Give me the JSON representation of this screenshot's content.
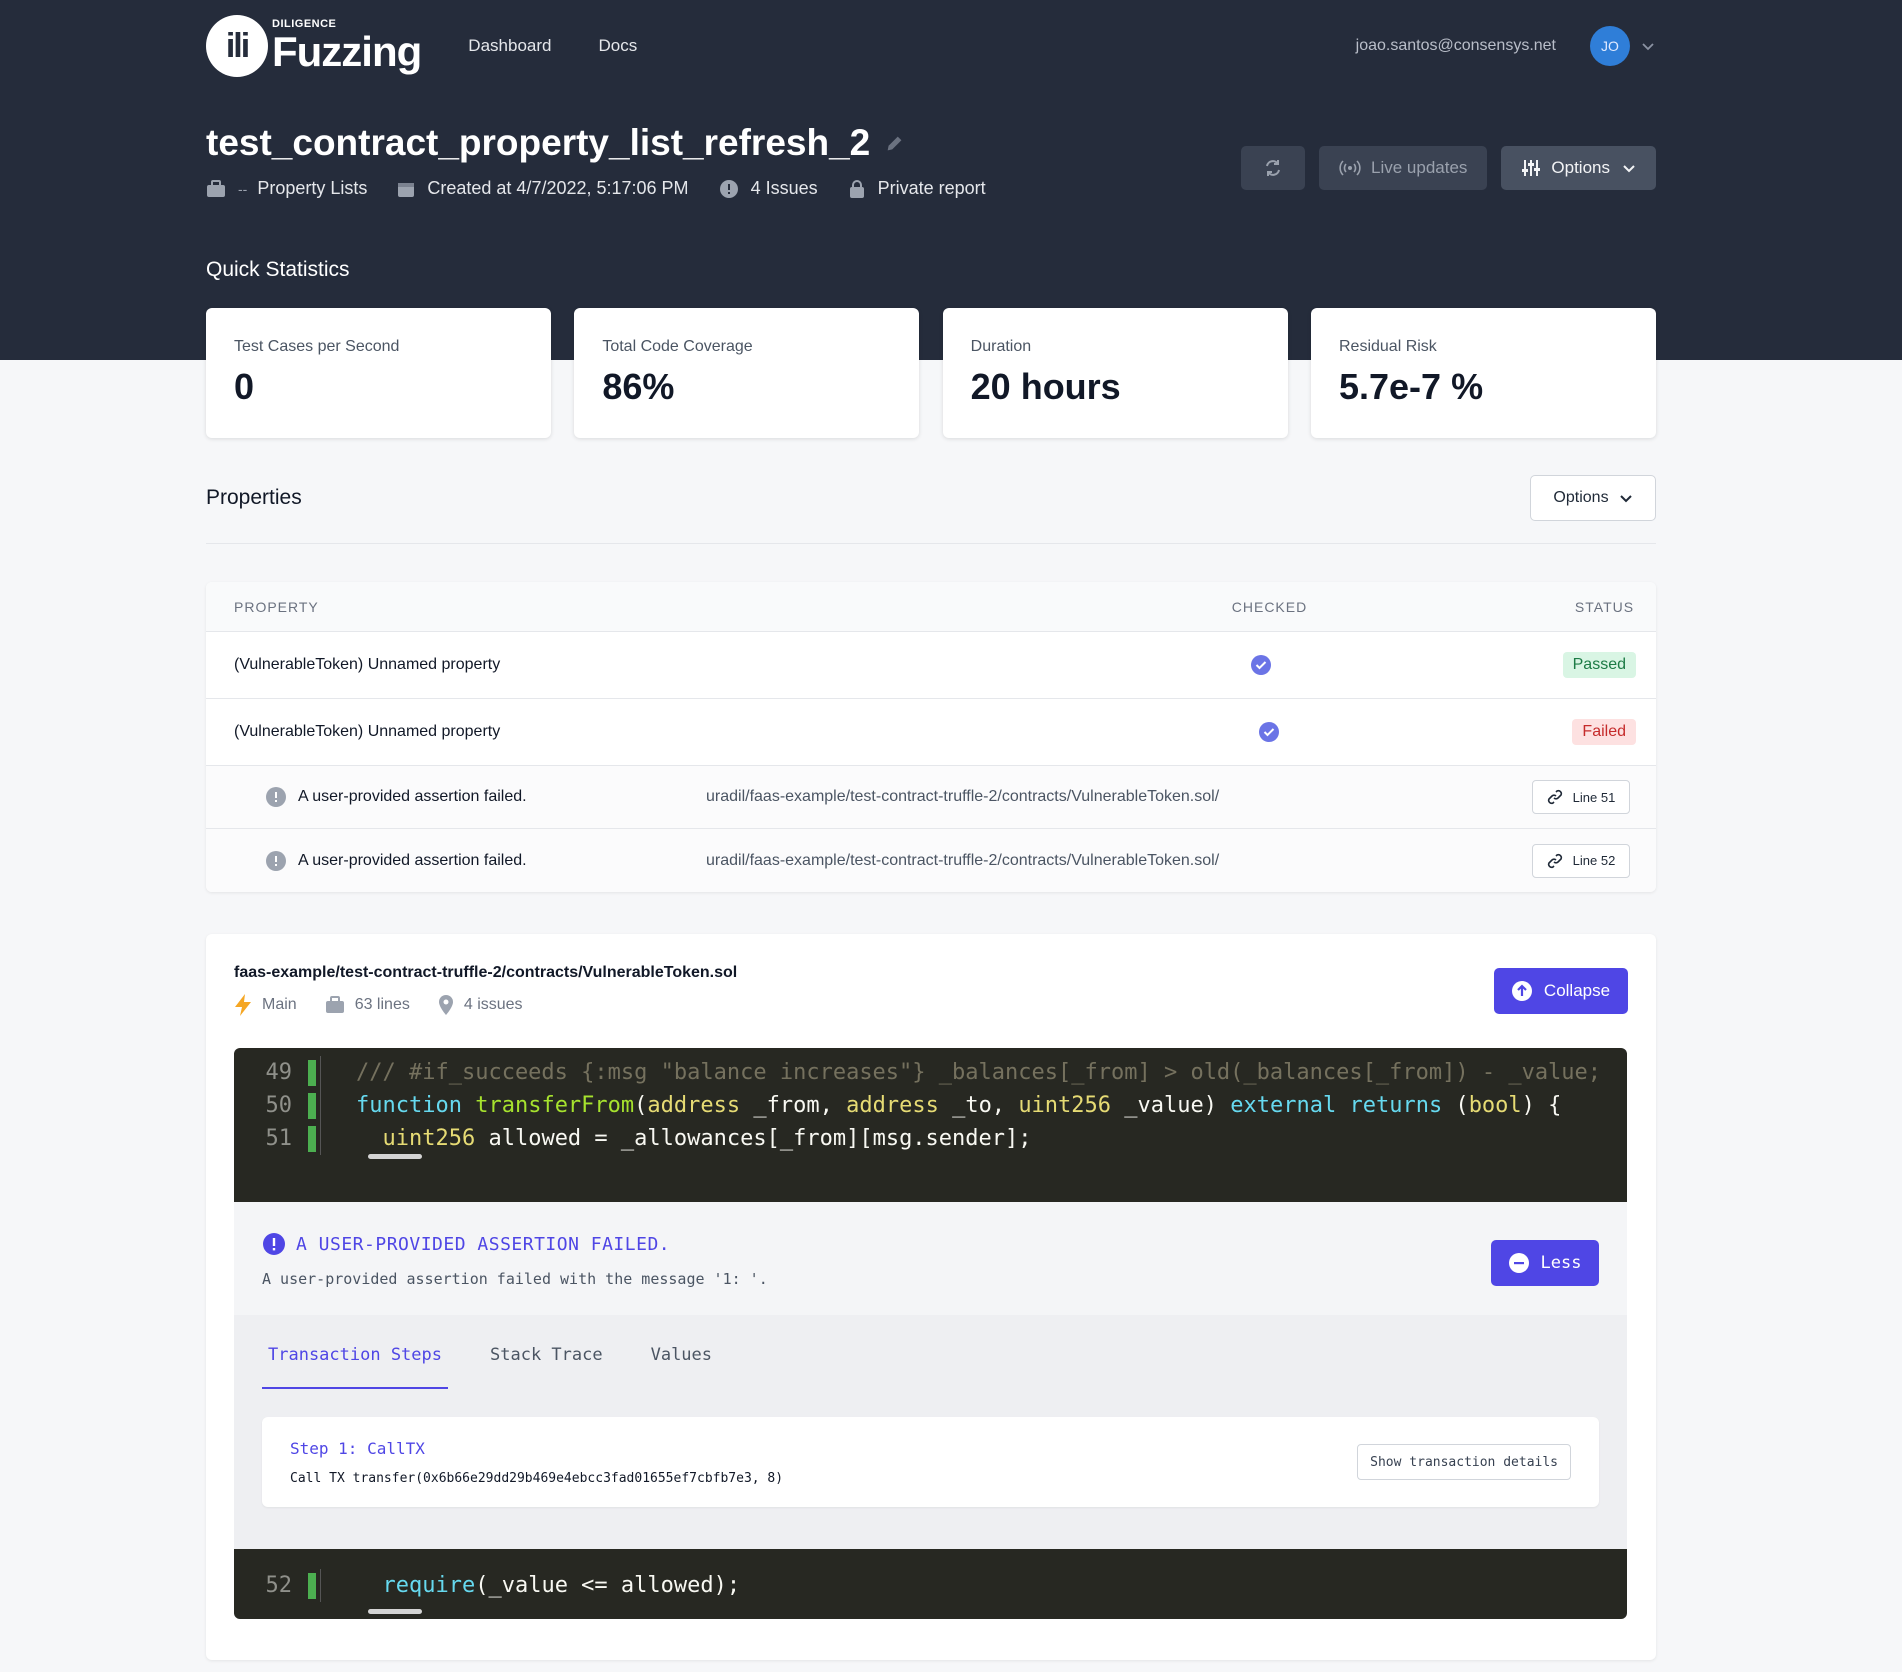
{
  "nav": {
    "logo_mark": "ili",
    "logo_small": "DILIGENCE",
    "logo_big": "Fuzzing",
    "links": [
      "Dashboard",
      "Docs"
    ],
    "email": "joao.santos@consensys.net",
    "avatar_initials": "JO"
  },
  "header": {
    "title": "test_contract_property_list_refresh_2",
    "meta_dash": "--",
    "meta_project": "Property Lists",
    "meta_created": "Created at 4/7/2022, 5:17:06 PM",
    "meta_issues": "4 Issues",
    "meta_privacy": "Private report",
    "live_updates_label": "Live updates",
    "options_label": "Options"
  },
  "quick_stats": {
    "label": "Quick Statistics",
    "items": [
      {
        "label": "Test Cases per Second",
        "value": "0"
      },
      {
        "label": "Total Code Coverage",
        "value": "86%"
      },
      {
        "label": "Duration",
        "value": "20 hours"
      },
      {
        "label": "Residual Risk",
        "value": "5.7e-7 %"
      }
    ]
  },
  "properties": {
    "title": "Properties",
    "options_label": "Options",
    "columns": [
      "PROPERTY",
      "CHECKED",
      "STATUS"
    ],
    "rows": [
      {
        "name": "(VulnerableToken) Unnamed property",
        "status": "Passed"
      },
      {
        "name": "(VulnerableToken) Unnamed property",
        "status": "Failed"
      }
    ],
    "issues": [
      {
        "message": "A user-provided assertion failed.",
        "path": "uradil/faas-example/test-contract-truffle-2/contracts/VulnerableToken.sol/",
        "line": "Line 51"
      },
      {
        "message": "A user-provided assertion failed.",
        "path": "uradil/faas-example/test-contract-truffle-2/contracts/VulnerableToken.sol/",
        "line": "Line 52"
      }
    ]
  },
  "file": {
    "path": "faas-example/test-contract-truffle-2/contracts/VulnerableToken.sol",
    "branch": "Main",
    "lines": "63 lines",
    "issues": "4 issues",
    "collapse_label": "Collapse",
    "code_top": [
      {
        "num": "49",
        "tokens": [
          {
            "t": "/// #if_succeeds {:msg \"balance increases\"} _balances[_from] > old(_balances[_from]) - _value;",
            "c": "cm"
          }
        ]
      },
      {
        "num": "50",
        "tokens": [
          {
            "t": "function",
            "c": "kw"
          },
          {
            "t": " ",
            "c": ""
          },
          {
            "t": "transferFrom",
            "c": "fn"
          },
          {
            "t": "(",
            "c": ""
          },
          {
            "t": "address",
            "c": "ty"
          },
          {
            "t": " _from, ",
            "c": ""
          },
          {
            "t": "address",
            "c": "ty"
          },
          {
            "t": " _to, ",
            "c": ""
          },
          {
            "t": "uint256",
            "c": "ty"
          },
          {
            "t": " _value) ",
            "c": ""
          },
          {
            "t": "external",
            "c": "kw"
          },
          {
            "t": " ",
            "c": ""
          },
          {
            "t": "returns",
            "c": "kw"
          },
          {
            "t": " (",
            "c": ""
          },
          {
            "t": "bool",
            "c": "ty"
          },
          {
            "t": ") {",
            "c": ""
          }
        ]
      },
      {
        "num": "51",
        "tokens": [
          {
            "t": "  ",
            "c": ""
          },
          {
            "t": "uint256",
            "c": "ty"
          },
          {
            "t": " allowed = _allowances[_from][msg.sender];",
            "c": ""
          }
        ]
      }
    ],
    "code_bottom": [
      {
        "num": "52",
        "tokens": [
          {
            "t": "  ",
            "c": ""
          },
          {
            "t": "require",
            "c": "kw"
          },
          {
            "t": "(_value <= allowed);",
            "c": ""
          }
        ]
      }
    ]
  },
  "issue_detail": {
    "title": "A USER-PROVIDED ASSERTION FAILED.",
    "description": "A user-provided assertion failed with the message '1: '.",
    "less_label": "Less",
    "tabs": [
      "Transaction Steps",
      "Stack Trace",
      "Values"
    ],
    "step_title": "Step 1: CallTX",
    "step_call": "Call TX transfer(0x6b66e29dd29b469e4ebcc3fad01655ef7cbfb7e3, 8)",
    "step_button": "Show transaction details"
  },
  "colors": {
    "header_bg": "#252c3b",
    "primary": "#4f46e5",
    "passed": "#1c7b45",
    "failed": "#c52b2b",
    "check": "#6b74e6"
  }
}
